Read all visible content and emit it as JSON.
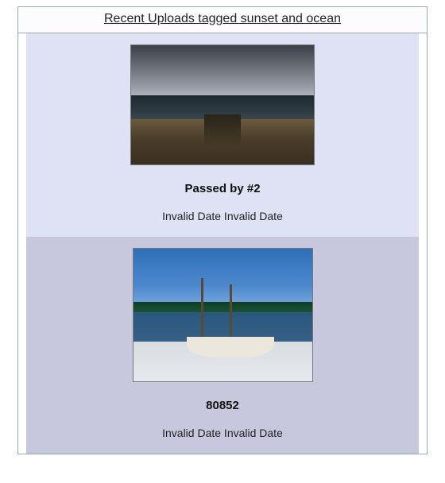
{
  "header": {
    "title": "Recent Uploads tagged sunset and ocean"
  },
  "items": [
    {
      "title": "Passed by #2",
      "date": "Invalid Date Invalid Date"
    },
    {
      "title": "80852",
      "date": "Invalid Date Invalid Date"
    }
  ]
}
